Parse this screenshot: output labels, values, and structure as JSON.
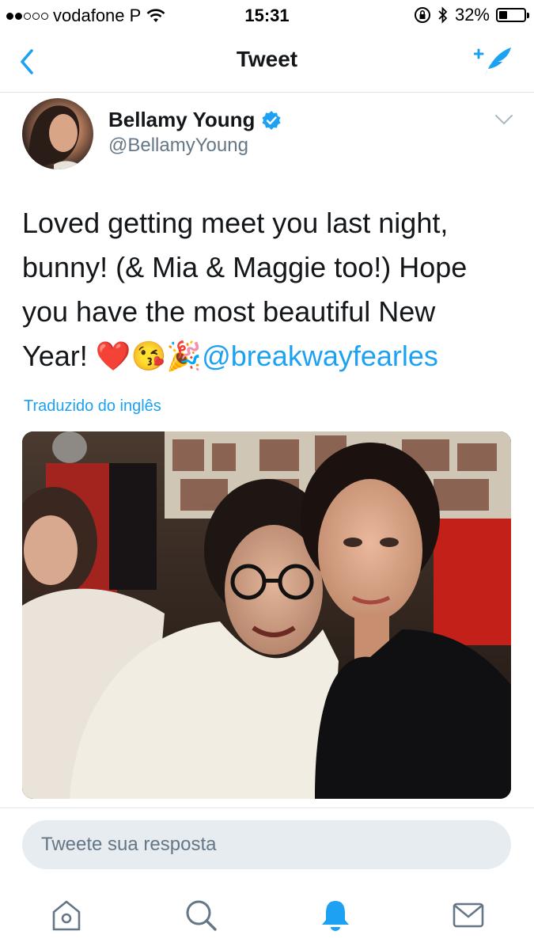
{
  "status_bar": {
    "carrier": "vodafone P",
    "time": "15:31",
    "battery": "32%",
    "battery_level": 0.32
  },
  "nav": {
    "title": "Tweet",
    "back_icon": "chevron-left-icon",
    "compose_icon": "compose-tweet-icon"
  },
  "tweet": {
    "author_name": "Bellamy Young",
    "author_handle": "@BellamyYoung",
    "verified": true,
    "text_line1": "Loved getting meet you  last night,",
    "text_line2": "bunny! (& Mia & Maggie too!) Hope",
    "text_line3": "you have the most beautiful New",
    "text_line4_start": "Year! ",
    "emojis": "❤️😘🎉",
    "mention": "@breakwayfearles",
    "translated_label": "Traduzido do inglês"
  },
  "reply": {
    "placeholder": "Tweete sua resposta"
  },
  "tabs": [
    {
      "icon": "home-icon"
    },
    {
      "icon": "search-icon"
    },
    {
      "icon": "notifications-bell-icon"
    },
    {
      "icon": "messages-envelope-icon"
    }
  ],
  "colors": {
    "accent": "#1da1f2",
    "text": "#14171a",
    "secondary": "#657786",
    "reply_bg": "#e6ecf0"
  }
}
